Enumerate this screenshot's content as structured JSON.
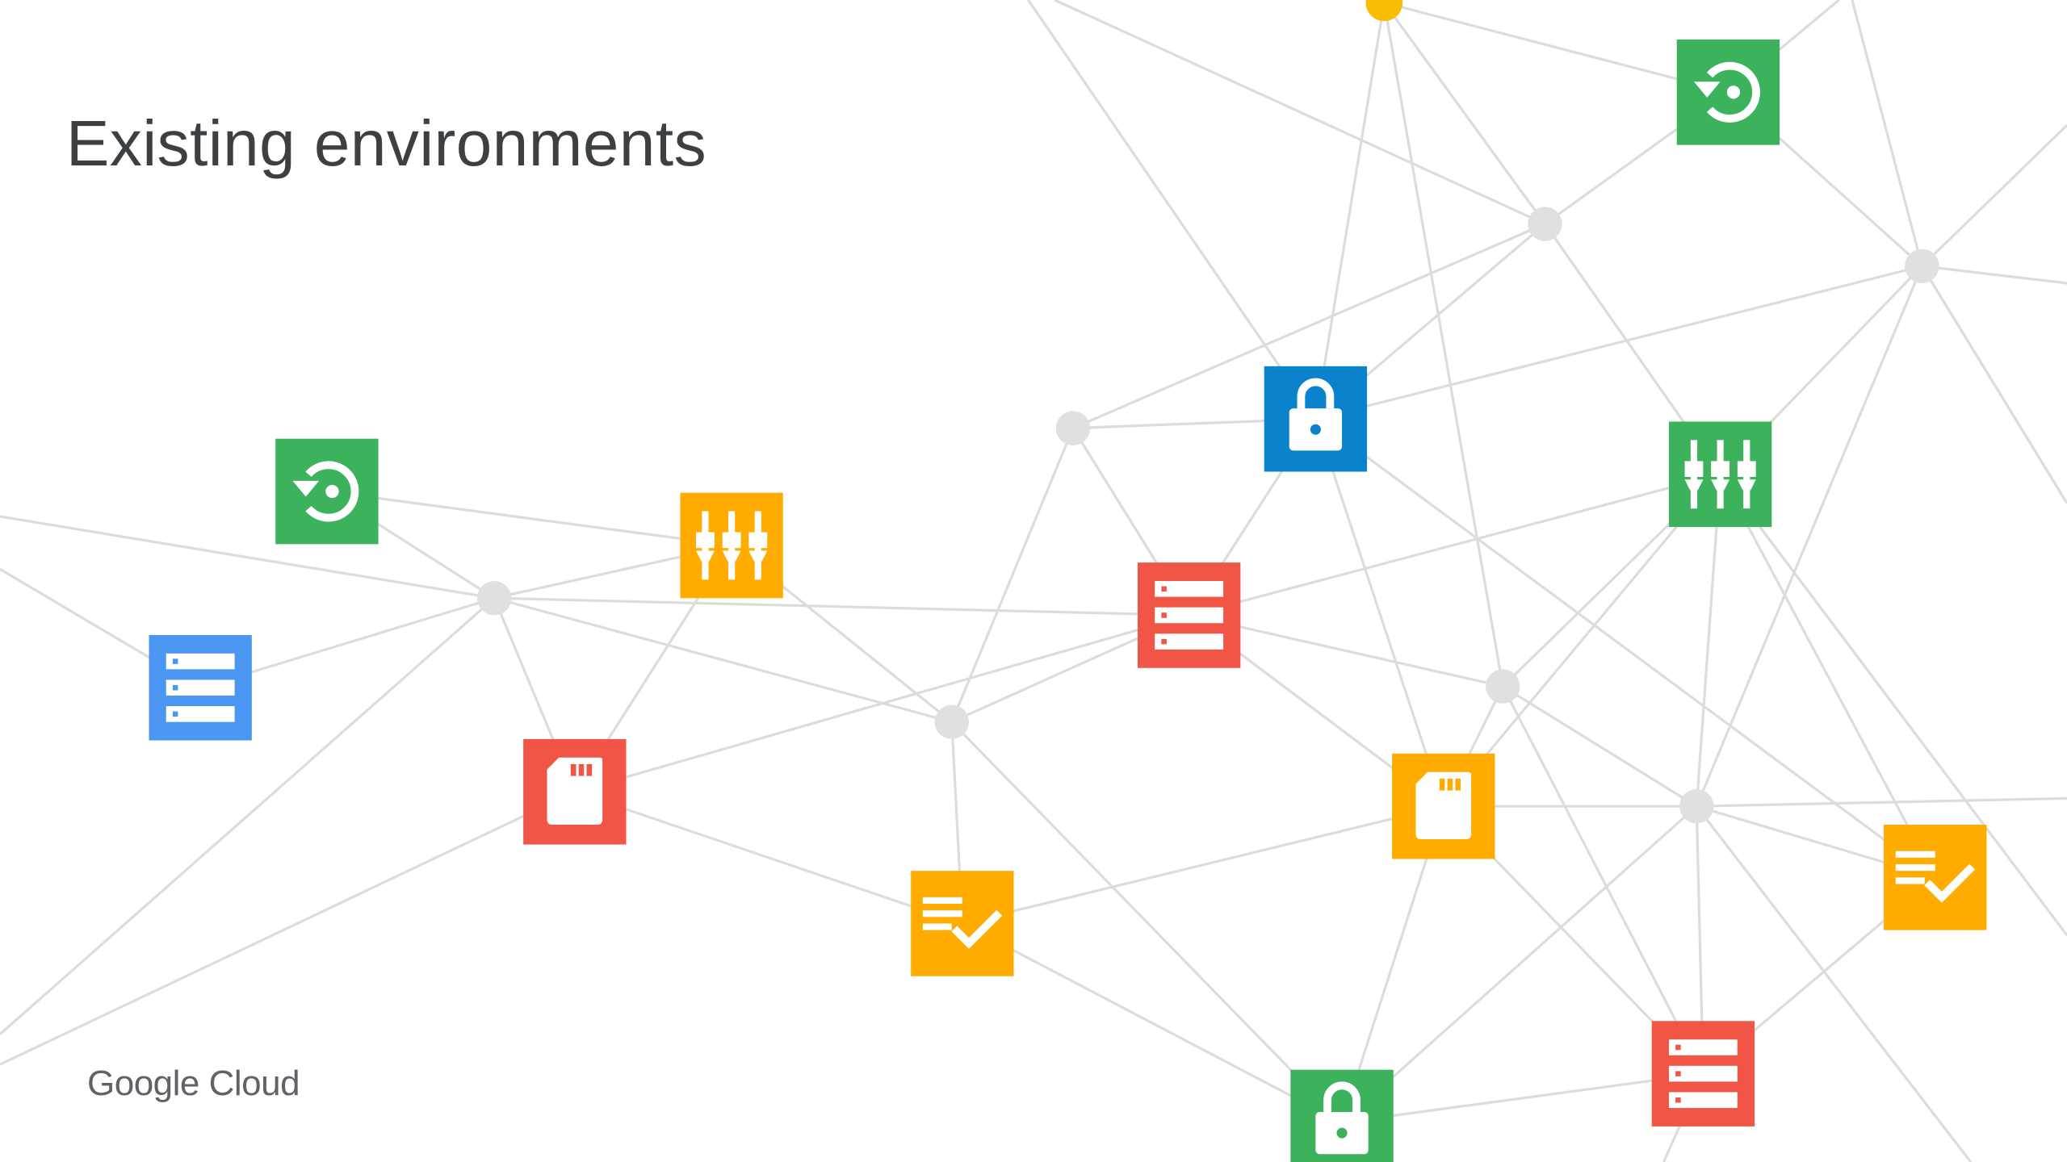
{
  "slide": {
    "title": "Existing environments",
    "logo_text": "Google Cloud"
  },
  "colors": {
    "line": "#dcdcdc",
    "hub": "#e0e0e0",
    "hub_accent": "#fbbc04",
    "green": "#3cb25c",
    "orange": "#ffab00",
    "red": "#f05545",
    "blue": "#4b96f0",
    "dark_blue": "#0b83cc",
    "glyph": "#ffffff"
  },
  "icon_types": {
    "backup": "backup-restore-icon",
    "mixer": "equalizer-sliders-icon",
    "server": "server-list-icon",
    "sdcard": "sd-card-icon",
    "checklist": "checklist-icon",
    "lock": "padlock-icon"
  }
}
